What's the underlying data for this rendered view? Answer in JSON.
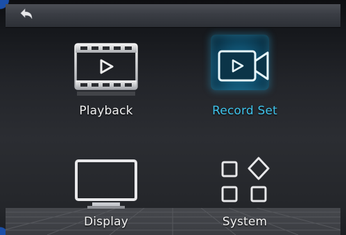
{
  "menu": {
    "items": [
      {
        "id": "playback",
        "label": "Playback",
        "icon": "film-play-icon",
        "selected": false
      },
      {
        "id": "record",
        "label": "Record Set",
        "icon": "video-camera-icon",
        "selected": true
      },
      {
        "id": "display",
        "label": "Display",
        "icon": "monitor-icon",
        "selected": false
      },
      {
        "id": "system",
        "label": "System",
        "icon": "apps-grid-icon",
        "selected": false
      }
    ]
  },
  "header": {
    "back_icon": "back-arrow-icon"
  },
  "colors": {
    "selected_label": "#3fc4ec",
    "label": "#f2f2f2",
    "highlight": "#0f4e6c"
  }
}
